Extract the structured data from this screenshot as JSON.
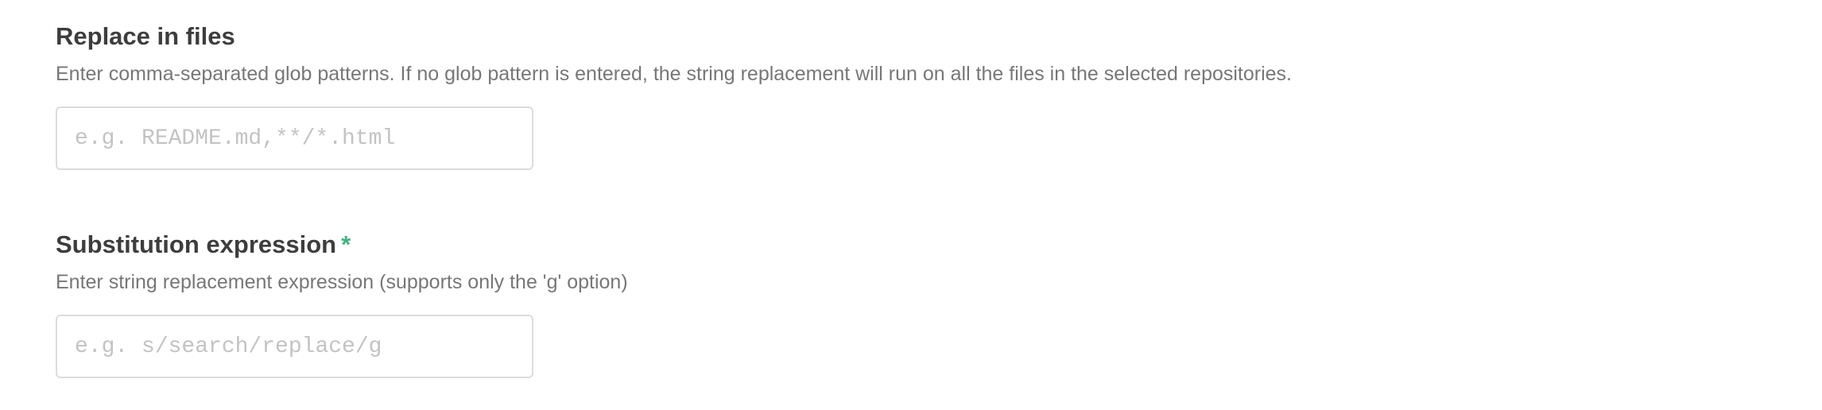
{
  "replace_in_files": {
    "title": "Replace in files",
    "help": "Enter comma-separated glob patterns. If no glob pattern is entered, the string replacement will run on all the files in the selected repositories.",
    "input_value": "",
    "input_placeholder": "e.g. README.md,**/*.html"
  },
  "substitution_expression": {
    "title": "Substitution expression",
    "required_mark": "*",
    "help": "Enter string replacement expression (supports only the 'g' option)",
    "input_value": "",
    "input_placeholder": "e.g. s/search/replace/g"
  },
  "colors": {
    "title_text": "#3d3d3d",
    "help_text": "#777777",
    "required_mark": "#3fb37f",
    "input_border": "#dcdcdc",
    "placeholder_text": "#c3c3c3"
  }
}
